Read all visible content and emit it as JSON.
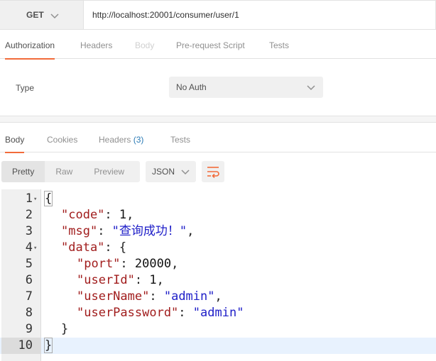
{
  "request": {
    "method": "GET",
    "url": "http://localhost:20001/consumer/user/1",
    "tabs": [
      "Authorization",
      "Headers",
      "Body",
      "Pre-request Script",
      "Tests"
    ]
  },
  "auth": {
    "type_label": "Type",
    "type_value": "No Auth"
  },
  "response": {
    "tabs": {
      "body": "Body",
      "cookies": "Cookies",
      "headers": "Headers",
      "headers_count": "(3)",
      "tests": "Tests"
    },
    "formats": [
      "Pretty",
      "Raw",
      "Preview"
    ],
    "language": "JSON",
    "lines": [
      {
        "n": "1",
        "open": "{"
      },
      {
        "n": "2",
        "key": "\"code\"",
        "sep": ": ",
        "num": "1",
        "end": ","
      },
      {
        "n": "3",
        "key": "\"msg\"",
        "sep": ": ",
        "str": "\"查询成功！\"",
        "end": ","
      },
      {
        "n": "4",
        "key": "\"data\"",
        "sep": ": ",
        "end": "{"
      },
      {
        "n": "5",
        "key": "\"port\"",
        "sep": ": ",
        "num": "20000",
        "end": ","
      },
      {
        "n": "6",
        "key": "\"userId\"",
        "sep": ": ",
        "num": "1",
        "end": ","
      },
      {
        "n": "7",
        "key": "\"userName\"",
        "sep": ": ",
        "str": "\"admin\"",
        "end": ","
      },
      {
        "n": "8",
        "key": "\"userPassword\"",
        "sep": ": ",
        "str": "\"admin\"",
        "end": ""
      },
      {
        "n": "9",
        "close": "}"
      },
      {
        "n": "10",
        "close": "}"
      }
    ]
  },
  "colors": {
    "accent": "#f26b3a",
    "json_key": "#a11d1d",
    "json_string": "#1e1ec8"
  }
}
